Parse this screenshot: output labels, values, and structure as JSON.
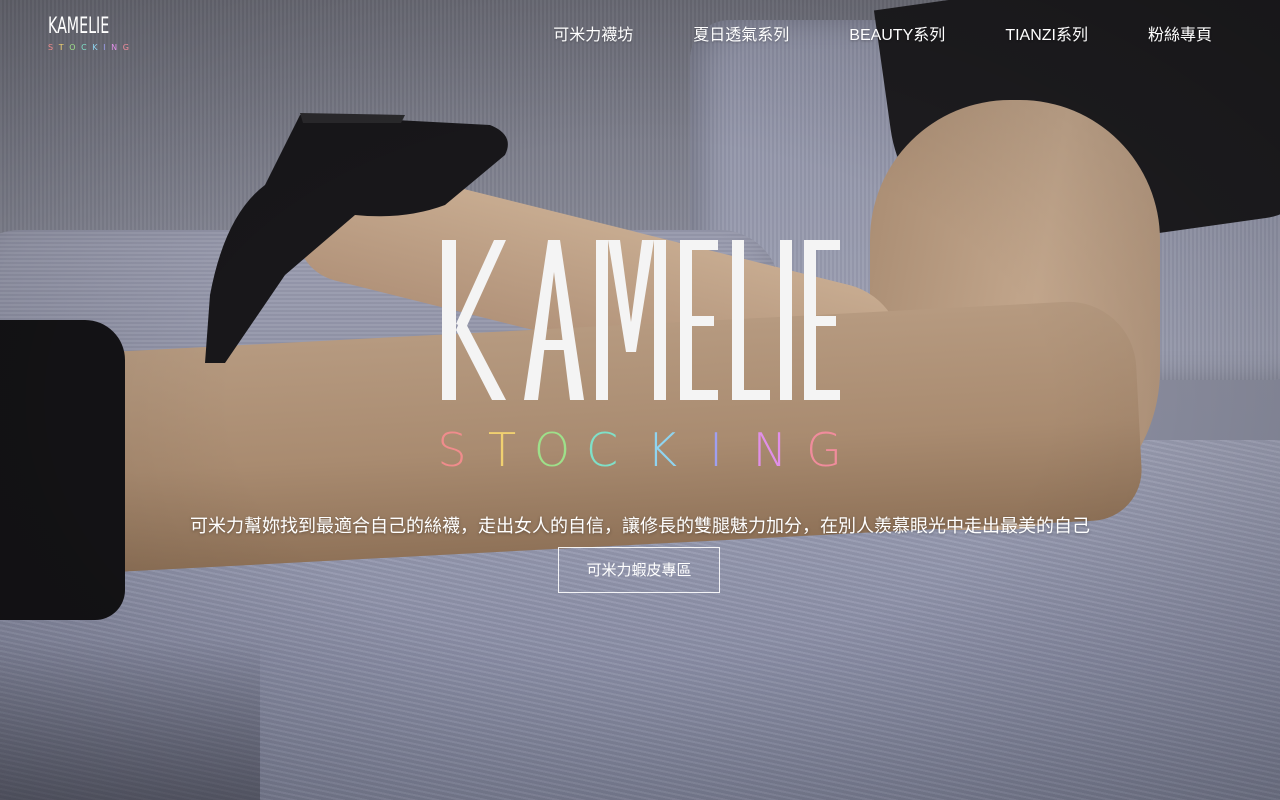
{
  "brand": {
    "logo_top": "KAMELIE",
    "logo_bottom_letters": [
      "S",
      "T",
      "O",
      "C",
      "K",
      "I",
      "N",
      "G"
    ],
    "logo_bottom_colors": [
      "#f08c8c",
      "#f0d070",
      "#9ee08a",
      "#7fe0c8",
      "#8fd4f0",
      "#9f9ff0",
      "#e08fe8",
      "#f08c9c"
    ]
  },
  "nav": {
    "items": [
      {
        "label": "可米力襪坊"
      },
      {
        "label": "夏日透氣系列"
      },
      {
        "label": "BEAUTY系列"
      },
      {
        "label": "TIANZI系列"
      },
      {
        "label": "粉絲專頁"
      }
    ]
  },
  "hero": {
    "logo_top": "KAMELIE",
    "logo_bottom_letters": [
      "S",
      "T",
      "O",
      "C",
      "K",
      "I",
      "N",
      "G"
    ],
    "tagline": "可米力幫妳找到最適合自己的絲襪，走出女人的自信，讓修長的雙腿魅力加分，在別人羨慕眼光中走出最美的自己",
    "cta_label": "可米力蝦皮專區"
  },
  "colors": {
    "text": "#ffffff",
    "logo_white": "#f4f4f4"
  },
  "background_photo": {
    "subject": "legs-in-stockings-and-black-high-heels-on-grey-sofa"
  }
}
